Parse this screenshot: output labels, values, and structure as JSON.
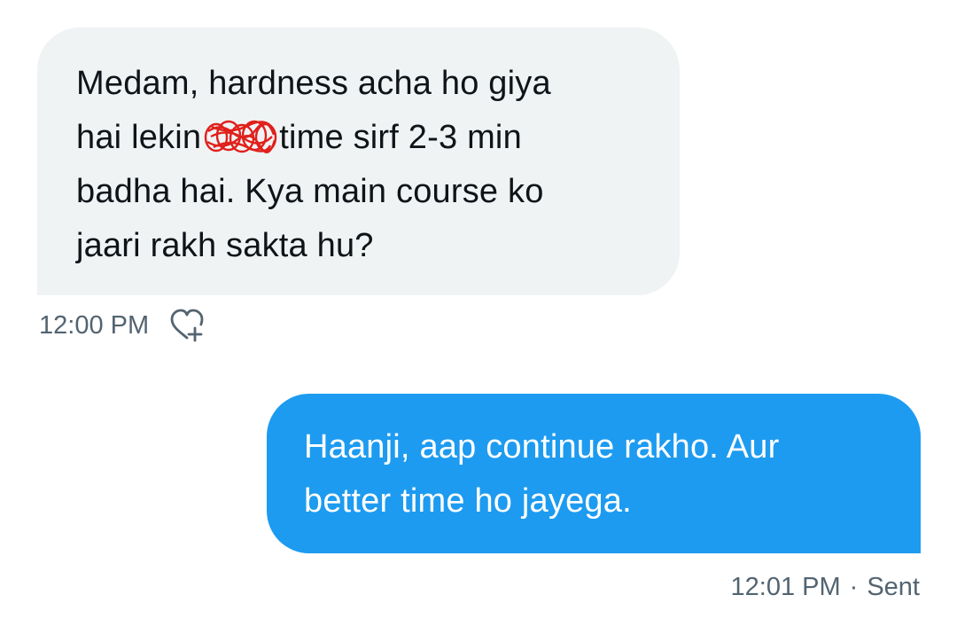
{
  "received_message": {
    "lines": [
      "Medam, hardness acha ho giya",
      [
        "hai lekin",
        "time sirf 2-3 min"
      ],
      "badha hai. Kya main course ko",
      "jaari rakh sakta hu?"
    ],
    "timestamp": "12:00 PM",
    "react_icon": "heart-plus-icon"
  },
  "sent_message": {
    "lines": [
      "Haanji, aap continue rakho. Aur",
      "better time ho jayega."
    ],
    "timestamp": "12:01 PM",
    "separator": "·",
    "status": "Sent"
  },
  "colors": {
    "received_bubble": "#eff3f4",
    "sent_bubble": "#1d9bf0",
    "meta_text": "#536471",
    "redaction": "#e0201b"
  }
}
